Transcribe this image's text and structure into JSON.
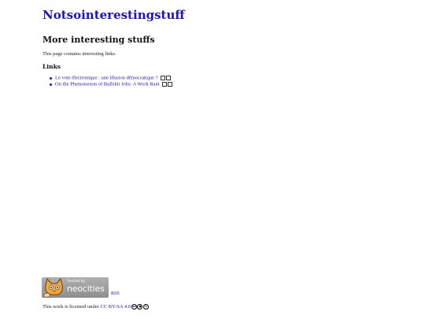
{
  "header": {
    "site_title": "Notsointerestingstuff"
  },
  "main": {
    "heading": "More interesting stuffs",
    "intro": "This page contains interesting links.",
    "links_heading": "Links",
    "links": [
      {
        "label": "Le vote électronique : une illusion démocratique ?"
      },
      {
        "label": "On the Phenomenon of Bullshit Jobs: A Work Rant"
      }
    ]
  },
  "footer": {
    "badge": {
      "small_text": "hosted by",
      "big_text": "neocities"
    },
    "rss_label": "RSS",
    "license_prefix": "This work is licensed under",
    "license_link": "CC BY-SA 4.0"
  },
  "colors": {
    "link": "#1a14c4",
    "badge_bg": "#9e9e9e"
  }
}
